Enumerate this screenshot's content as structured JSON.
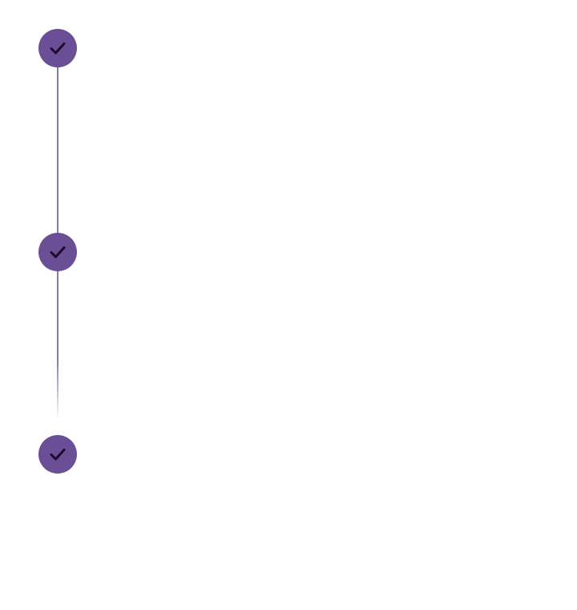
{
  "stepper": {
    "colors": {
      "circle": "#6b4f96",
      "check": "#1a0b2e",
      "connector": "#8b7aa8"
    },
    "steps": [
      {
        "status": "completed",
        "icon": "check-icon"
      },
      {
        "status": "completed",
        "icon": "check-icon"
      },
      {
        "status": "completed",
        "icon": "check-icon"
      }
    ]
  }
}
